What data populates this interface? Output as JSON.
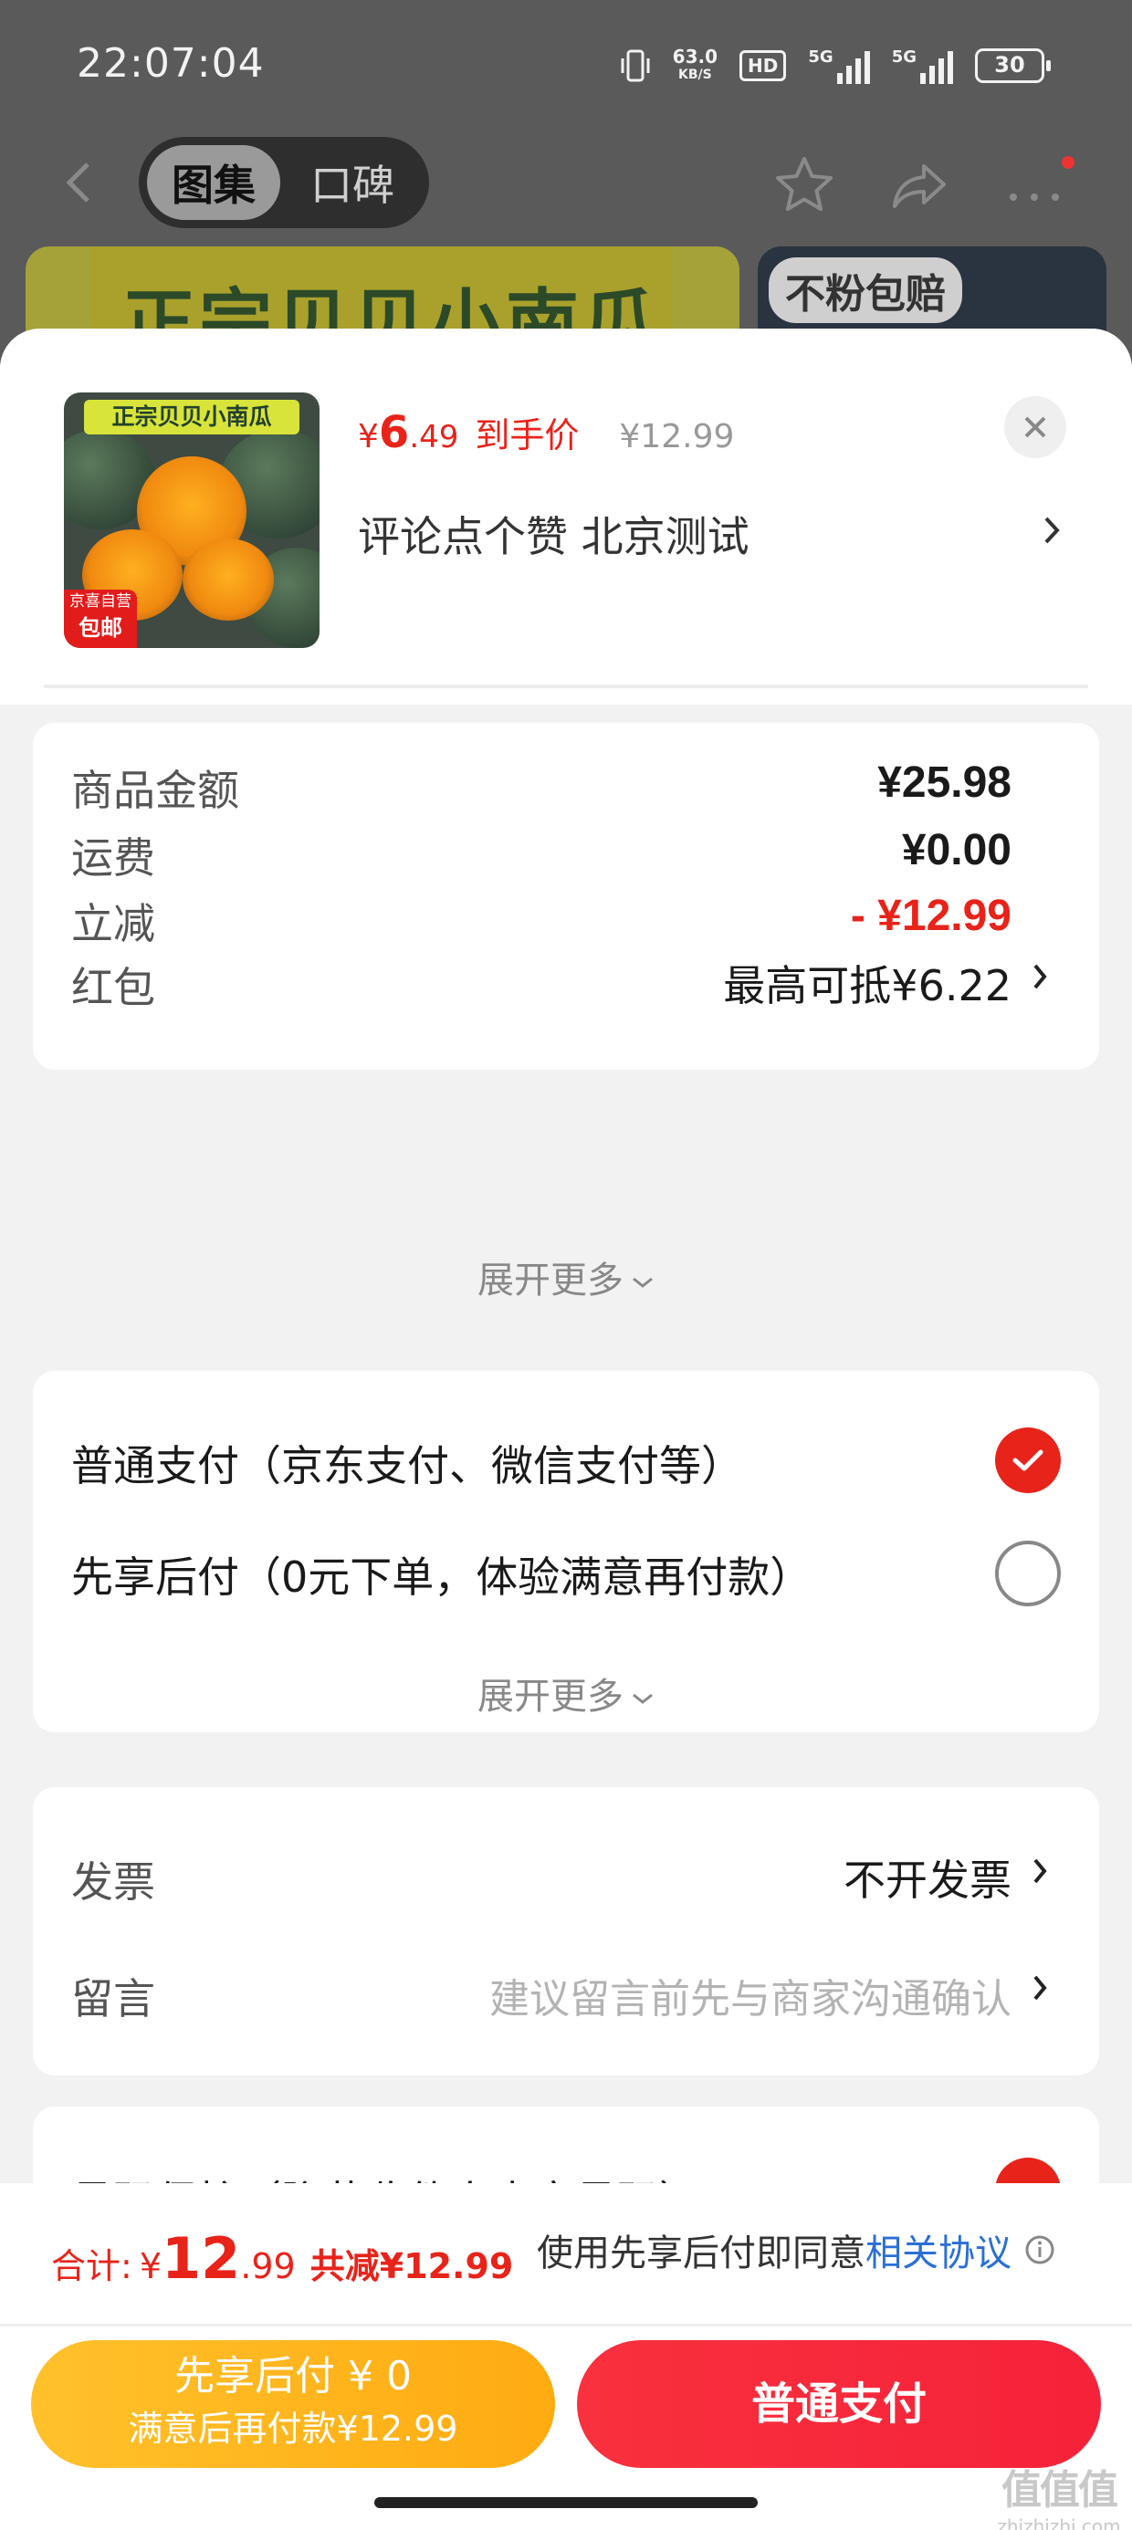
{
  "status_bar": {
    "time": "22:07:04",
    "net_speed": "63.0",
    "net_unit": "KB/S",
    "hd_label": "HD",
    "signal1": "5G",
    "signal2": "5G",
    "battery": "30"
  },
  "nav": {
    "tab_gallery": "图集",
    "tab_reviews": "口碑",
    "icons": [
      "back-icon",
      "star-icon",
      "share-icon",
      "more-icon"
    ]
  },
  "background_banners": {
    "left_text": "正宗贝贝小南瓜",
    "right_text": "不粉包赔"
  },
  "product": {
    "image_title": "正宗贝贝小南瓜",
    "image_tag_line1": "京喜自营",
    "image_tag_line2": "包邮",
    "price_currency": "¥",
    "price_int": "6",
    "price_dec": ".49",
    "price_label": "到手价",
    "original_price": "¥12.99",
    "description": "评论点个赞  北京测试"
  },
  "amounts": {
    "goods_label": "商品金额",
    "goods_value": "¥25.98",
    "shipping_label": "运费",
    "shipping_value": "¥0.00",
    "discount_label": "立减",
    "discount_value": "- ¥12.99",
    "redpacket_label": "红包",
    "redpacket_value": "最高可抵¥6.22",
    "expand_label": "展开更多"
  },
  "payment": {
    "option_normal": "普通支付（京东支付、微信支付等）",
    "option_normal_selected": true,
    "option_bnpl": "先享后付（0元下单，体验满意再付款）",
    "option_bnpl_selected": false,
    "expand_label": "展开更多"
  },
  "extras": {
    "invoice_label": "发票",
    "invoice_value": "不开发票",
    "message_label": "留言",
    "message_placeholder": "建议留言前先与商家沟通确认"
  },
  "partial_card": {
    "label": "号码保护（隐藏收件人真实号码）"
  },
  "footer": {
    "total_label": "合计:",
    "total_currency": "¥",
    "total_int": "12",
    "total_dec": ".99",
    "total_saved": "共减¥12.99",
    "agree_prefix": "使用先享后付即同意",
    "agree_link": "相关协议",
    "btn_bnpl_line1": "先享后付 ¥ 0",
    "btn_bnpl_line2": "满意后再付款¥12.99",
    "btn_pay": "普通支付"
  },
  "watermark": {
    "text": "值值值",
    "domain": "zhizhizhi.com"
  },
  "colors": {
    "accent_red": "#e8231a",
    "link_blue": "#2a6fd6",
    "bnpl_yellow": "#ffb41e"
  }
}
